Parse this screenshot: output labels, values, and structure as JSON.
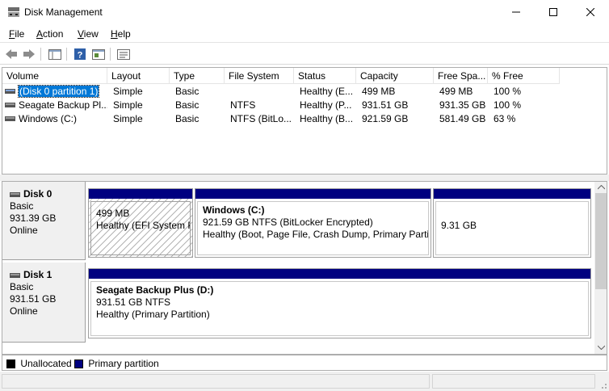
{
  "window": {
    "title": "Disk Management"
  },
  "menu": [
    {
      "label": "File",
      "key": "F",
      "rest": "ile"
    },
    {
      "label": "Action",
      "key": "A",
      "rest": "ction"
    },
    {
      "label": "View",
      "key": "V",
      "rest": "iew"
    },
    {
      "label": "Help",
      "key": "H",
      "rest": "elp"
    }
  ],
  "toolbar": [
    "back-icon",
    "forward-icon",
    "console-tree-icon",
    "help-icon",
    "properties-icon",
    "list-view-icon"
  ],
  "volume_list": {
    "columns": [
      "Volume",
      "Layout",
      "Type",
      "File System",
      "Status",
      "Capacity",
      "Free Spa...",
      "% Free"
    ],
    "rows": [
      [
        "(Disk 0 partition 1)",
        "Simple",
        "Basic",
        "",
        "Healthy (E...",
        "499 MB",
        "499 MB",
        "100 %"
      ],
      [
        "Seagate Backup Pl...",
        "Simple",
        "Basic",
        "NTFS",
        "Healthy (P...",
        "931.51 GB",
        "931.35 GB",
        "100 %"
      ],
      [
        "Windows (C:)",
        "Simple",
        "Basic",
        "NTFS (BitLo...",
        "Healthy (B...",
        "921.59 GB",
        "581.49 GB",
        "63 %"
      ]
    ],
    "selected_row": 0
  },
  "disks": [
    {
      "name": "Disk 0",
      "type": "Basic",
      "size": "931.39 GB",
      "status": "Online",
      "partitions": [
        {
          "title": "",
          "line1": "499 MB",
          "line2": "Healthy (EFI System Pa",
          "hatched": true
        },
        {
          "title": "Windows  (C:)",
          "line1": "921.59 GB NTFS (BitLocker Encrypted)",
          "line2": "Healthy (Boot, Page File, Crash Dump, Primary Partiti",
          "hatched": false
        },
        {
          "title": "",
          "line1": "9.31 GB",
          "line2": "",
          "hatched": false
        }
      ]
    },
    {
      "name": "Disk 1",
      "type": "Basic",
      "size": "931.51 GB",
      "status": "Online",
      "partitions": [
        {
          "title": "Seagate Backup Plus  (D:)",
          "line1": "931.51 GB NTFS",
          "line2": "Healthy (Primary Partition)",
          "hatched": false
        }
      ]
    }
  ],
  "legend": [
    {
      "label": "Unallocated",
      "color": "#000000"
    },
    {
      "label": "Primary partition",
      "color": "#000080"
    }
  ]
}
